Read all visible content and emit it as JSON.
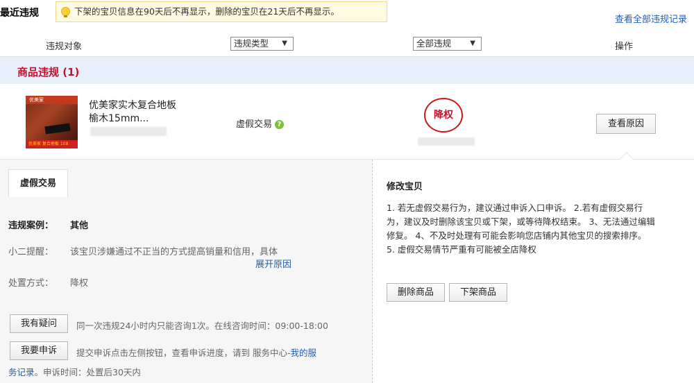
{
  "header": {
    "title": "最近违规",
    "notice": "下架的宝贝信息在90天后不再显示，删除的宝贝在21天后不再显示。",
    "all_records_link": "查看全部违规记录"
  },
  "columns": {
    "object": "违规对象",
    "type_select": "违规类型",
    "status_select": "全部违规",
    "action": "操作",
    "arrow": "▼"
  },
  "category": {
    "label": "商品违规 (1)"
  },
  "item": {
    "name_line1": "优美家实木复合地板",
    "name_line2": "榆木15mm...",
    "violation_type": "虚假交易",
    "help_icon": "?",
    "penalty_stamp": "降权",
    "reason_button": "查看原因",
    "thumb_top": "优美家",
    "thumb_bar": "优美家 复合地板 108"
  },
  "detail": {
    "tab": "虚假交易",
    "case_label": "违规案例：",
    "case_value": "其他",
    "remind_label": "小二提醒：",
    "remind_value": "该宝贝涉嫌通过不正当的方式提高销量和信用，具体",
    "expand_link": "展开原因",
    "handle_label": "处置方式：",
    "handle_value": "降权",
    "doubt_button": "我有疑问",
    "doubt_text": "同一次违规24小时内只能咨询1次。在线咨询时间：09:00-18:00",
    "appeal_button": "我要申诉",
    "appeal_text_before": "提交申诉点击左侧按钮，查看申诉进度，请到 服务中心-",
    "appeal_link_part1": "我的服",
    "appeal_link_part2": "务记录",
    "appeal_text_after": "。申诉时间：处置后30天内"
  },
  "fix": {
    "title": "修改宝贝",
    "body": "1. 若无虚假交易行为，建议通过申诉入口申诉。 2.若有虚假交易行为，建议及时删除该宝贝或下架，或等待降权结束。 3、无法通过编辑修复。 4、不及时处理有可能会影响您店铺内其他宝贝的搜索排序。 5. 虚假交易情节严重有可能被全店降权",
    "delete_button": "删除商品",
    "offshelf_button": "下架商品"
  },
  "colors": {
    "accent_red": "#c8102e",
    "link_blue": "#1f5fb5",
    "category_bg": "#e8f0fb",
    "notice_bg": "#fffbe2"
  },
  "icons": [
    "lightbulb-icon",
    "dropdown-arrow-icon",
    "question-icon",
    "penalty-stamp"
  ]
}
